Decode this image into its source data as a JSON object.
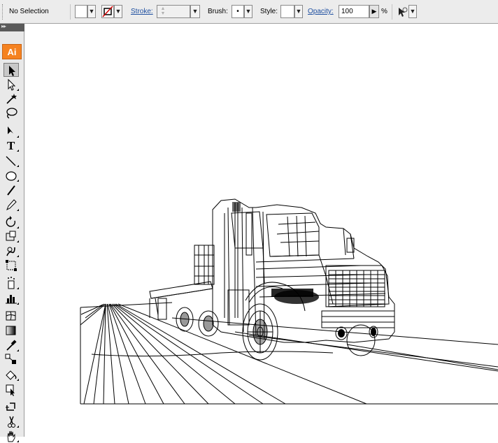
{
  "control_bar": {
    "selection_label": "No Selection",
    "stroke_label": "Stroke:",
    "stroke_weight": "",
    "brush_label": "Brush:",
    "brush_value": "•",
    "style_label": "Style:",
    "opacity_label": "Opacity:",
    "opacity_value": "100",
    "percent_sign": "%"
  },
  "tools_panel": {
    "logo": "Ai",
    "collapse_glyph": "▸▸",
    "tools": [
      "selection-tool",
      "direct-selection-tool",
      "magic-wand-tool",
      "lasso-tool",
      "pen-tool",
      "type-tool",
      "line-segment-tool",
      "ellipse-tool",
      "paintbrush-tool",
      "pencil-tool",
      "rotate-tool",
      "scale-tool",
      "warp-tool",
      "free-transform-tool",
      "symbol-sprayer-tool",
      "column-graph-tool",
      "mesh-tool",
      "gradient-tool",
      "eyedropper-tool",
      "blend-tool",
      "live-paint-bucket-tool",
      "live-paint-selection-tool",
      "crop-area-tool",
      "scissors-tool",
      "hand-tool"
    ],
    "active_tool": "selection-tool"
  },
  "colors": {
    "logo_orange": "#f58220",
    "link_blue": "#1e4fa0",
    "no_stroke_red": "#d00000"
  },
  "canvas": {
    "content": "wireframe truck on perspective road"
  }
}
